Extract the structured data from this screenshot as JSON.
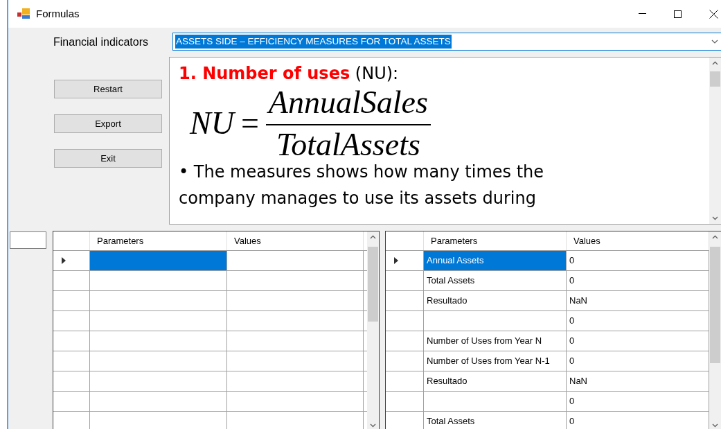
{
  "window": {
    "title": "Formulas"
  },
  "indicator": {
    "label": "Financial indicators",
    "value": "ASSETS SIDE – EFFICIENCY MEASURES FOR TOTAL ASSETS",
    "selected": true
  },
  "buttons": [
    "Restart",
    "Export",
    "Exit"
  ],
  "document": {
    "heading": "1. Number of uses",
    "heading_suffix": "(NU):",
    "formula": {
      "lhs": "NU",
      "operator": "=",
      "numerator": "AnnualSales",
      "denominator": "TotalAssets"
    },
    "bullet": "•",
    "lines": [
      "The measures shows how many times the",
      "company manages to use its assets during"
    ]
  },
  "left_grid": {
    "columns": [
      "Parameters",
      "Values"
    ],
    "rows": [
      {
        "selected": true
      },
      {
        "selected": false
      },
      {
        "selected": false
      },
      {
        "selected": false
      },
      {
        "selected": false
      },
      {
        "selected": false
      },
      {
        "selected": false
      },
      {
        "selected": false
      },
      {
        "selected": false
      }
    ]
  },
  "right_grid": {
    "columns": [
      "Parameters",
      "Values"
    ],
    "rows": [
      {
        "parameter": "Annual Assets",
        "value": "0",
        "selected": true
      },
      {
        "parameter": "Total Assets",
        "value": "0",
        "selected": false
      },
      {
        "parameter": "Resultado",
        "value": "NaN",
        "selected": false
      },
      {
        "value": "0",
        "selected": false
      },
      {
        "parameter": "Number of Uses from Year N",
        "value": "0",
        "selected": false
      },
      {
        "parameter": "Number of Uses from Year N-1",
        "value": "0",
        "selected": false
      },
      {
        "parameter": "Resultado",
        "value": "NaN",
        "selected": false
      },
      {
        "value": "0",
        "selected": false
      },
      {
        "parameter": "Total Assets",
        "value": "0",
        "selected": false
      }
    ]
  }
}
